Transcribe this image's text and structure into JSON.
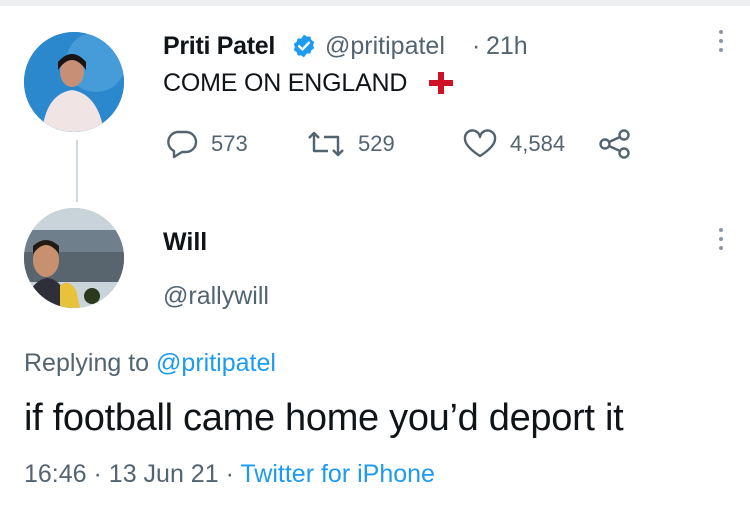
{
  "parent_tweet": {
    "display_name": "Priti Patel",
    "handle": "@pritipatel",
    "separator": "·",
    "time_ago": "21h",
    "text": "COME ON ENGLAND",
    "flag_icon": "england-flag-icon",
    "verified_icon": "verified-badge-icon",
    "stats": {
      "replies": "573",
      "retweets": "529",
      "likes": "4,584"
    }
  },
  "reply_tweet": {
    "display_name": "Will",
    "handle": "@rallywill",
    "replying_prefix": "Replying to ",
    "replying_to": "@pritipatel",
    "text": "if football came home you’d deport it",
    "time": "16:46",
    "separator": "·",
    "date": "13 Jun 21",
    "client": "Twitter for iPhone"
  },
  "colors": {
    "link": "#1d9bf0",
    "secondary_text": "#536471",
    "verified": "#1d9bf0",
    "flag_red": "#ce1124"
  }
}
